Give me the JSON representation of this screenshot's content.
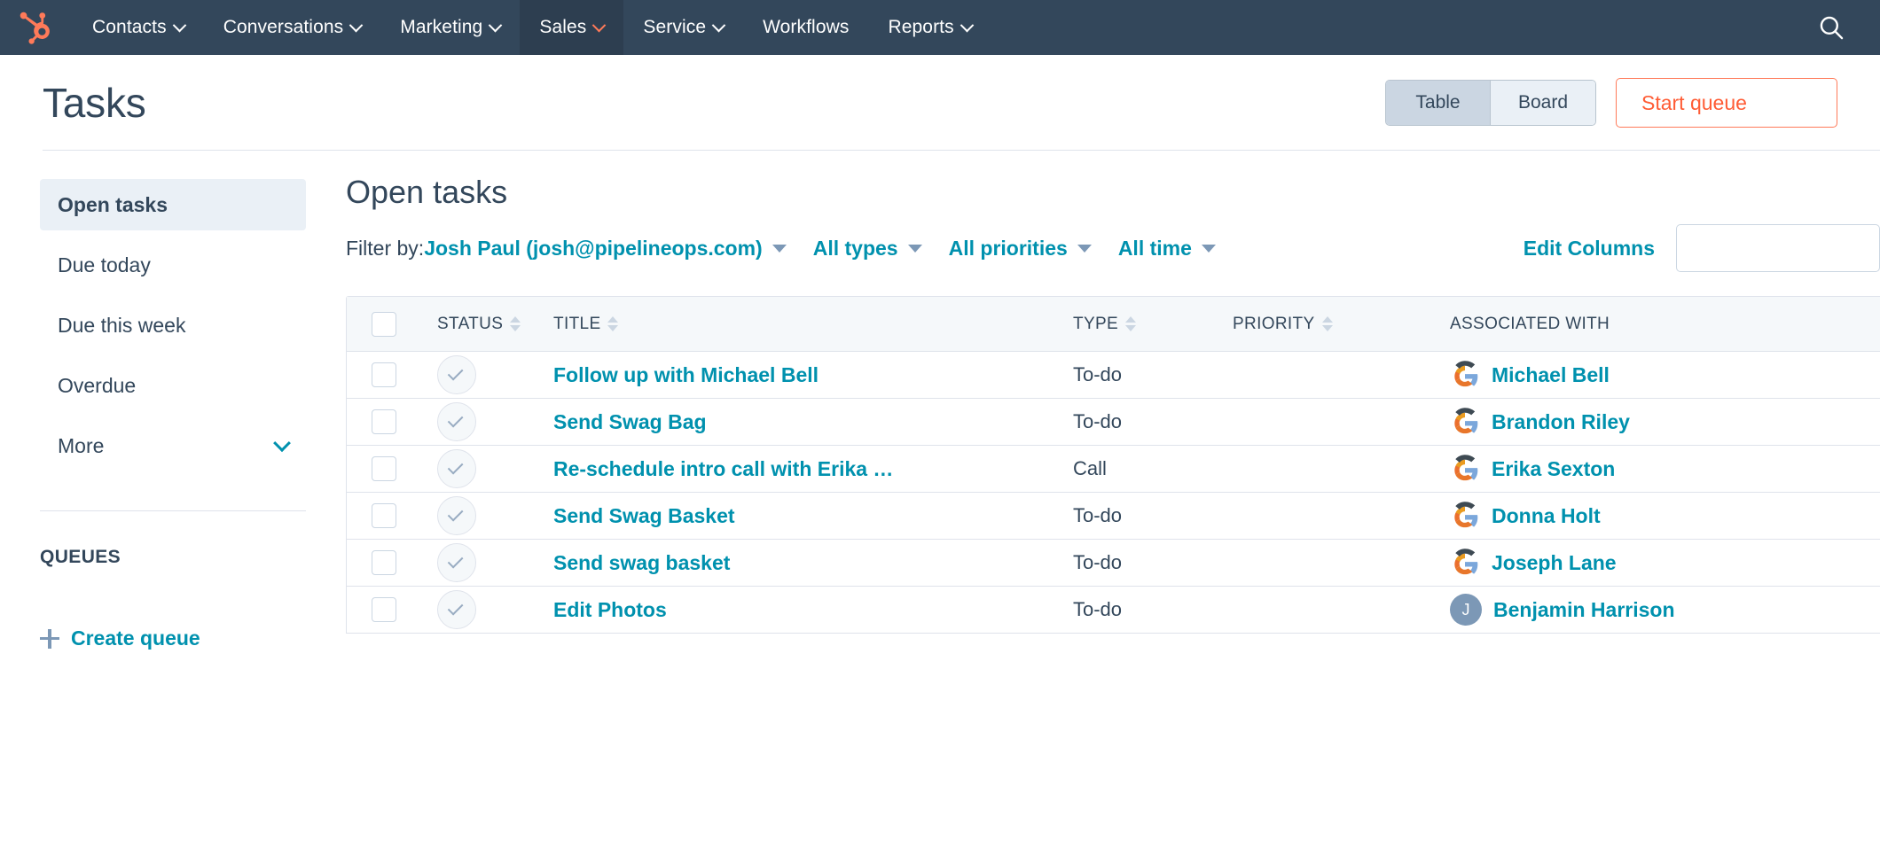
{
  "nav": {
    "logo_icon": "hubspot-sprocket-logo",
    "items": [
      {
        "label": "Contacts",
        "has_caret": true,
        "active": false
      },
      {
        "label": "Conversations",
        "has_caret": true,
        "active": false
      },
      {
        "label": "Marketing",
        "has_caret": true,
        "active": false
      },
      {
        "label": "Sales",
        "has_caret": true,
        "active": true
      },
      {
        "label": "Service",
        "has_caret": true,
        "active": false
      },
      {
        "label": "Workflows",
        "has_caret": false,
        "active": false
      },
      {
        "label": "Reports",
        "has_caret": true,
        "active": false
      }
    ],
    "search_icon": "search-icon",
    "background": "#33475b",
    "active_background": "#2d3e50",
    "active_caret_color": "#ff7a59"
  },
  "header": {
    "title": "Tasks",
    "view_toggle": {
      "options": [
        "Table",
        "Board"
      ],
      "selected": "Table"
    },
    "primary_button": "Start queue"
  },
  "sidebar": {
    "items": [
      {
        "label": "Open tasks",
        "active": true,
        "has_chevron": false
      },
      {
        "label": "Due today",
        "active": false,
        "has_chevron": false
      },
      {
        "label": "Due this week",
        "active": false,
        "has_chevron": false
      },
      {
        "label": "Overdue",
        "active": false,
        "has_chevron": false
      },
      {
        "label": "More",
        "active": false,
        "has_chevron": true
      }
    ],
    "queues_label": "QUEUES",
    "create_queue_label": "Create queue"
  },
  "main": {
    "title": "Open tasks",
    "filter_by_label": "Filter by:",
    "filters": [
      {
        "label": "Josh Paul (josh@pipelineops.com)"
      },
      {
        "label": "All types"
      },
      {
        "label": "All priorities"
      },
      {
        "label": "All time"
      }
    ],
    "edit_columns_label": "Edit Columns",
    "search_placeholder": ""
  },
  "table": {
    "columns": [
      {
        "label": "STATUS",
        "sortable": true
      },
      {
        "label": "TITLE",
        "sortable": true
      },
      {
        "label": "TYPE",
        "sortable": true
      },
      {
        "label": "PRIORITY",
        "sortable": true
      },
      {
        "label": "ASSOCIATED WITH",
        "sortable": false
      }
    ],
    "rows": [
      {
        "title": "Follow up with Michael Bell",
        "type": "To-do",
        "priority": "",
        "associated": "Michael Bell",
        "avatar": "google-logo-avatar",
        "initial": ""
      },
      {
        "title": "Send Swag Bag",
        "type": "To-do",
        "priority": "",
        "associated": "Brandon Riley",
        "avatar": "google-logo-avatar",
        "initial": ""
      },
      {
        "title": "Re-schedule intro call with Erika …",
        "type": "Call",
        "priority": "",
        "associated": "Erika Sexton",
        "avatar": "google-logo-avatar",
        "initial": ""
      },
      {
        "title": "Send Swag Basket",
        "type": "To-do",
        "priority": "",
        "associated": "Donna Holt",
        "avatar": "google-logo-avatar",
        "initial": ""
      },
      {
        "title": "Send swag basket",
        "type": "To-do",
        "priority": "",
        "associated": "Joseph Lane",
        "avatar": "google-logo-avatar",
        "initial": ""
      },
      {
        "title": "Edit Photos",
        "type": "To-do",
        "priority": "",
        "associated": "Benjamin Harrison",
        "avatar": "initial-avatar",
        "initial": "J"
      }
    ]
  },
  "colors": {
    "brand_orange": "#ff7a59",
    "nav_dark": "#33475b",
    "link_teal": "#0091ae",
    "selected_bg": "#eaf0f6"
  }
}
